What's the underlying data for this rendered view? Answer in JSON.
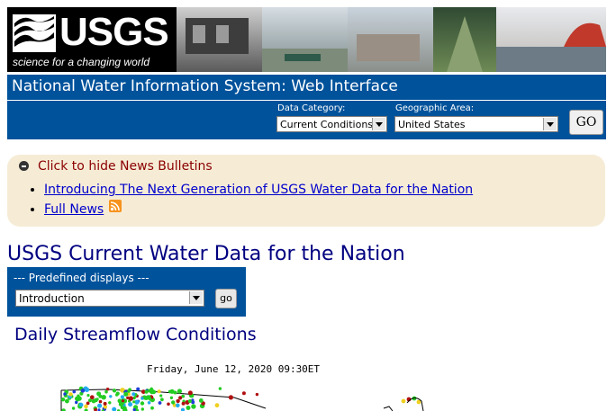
{
  "header": {
    "logo_text": "USGS",
    "tagline": "science for a changing world",
    "title": "National Water Information System: Web Interface"
  },
  "toolbar": {
    "data_category_label": "Data Category:",
    "data_category_value": "Current Conditions",
    "geographic_area_label": "Geographic Area:",
    "geographic_area_value": "United States",
    "go_label": "GO"
  },
  "news": {
    "toggle_label": "Click to hide News Bulletins",
    "items": [
      {
        "label": "Introducing The Next Generation of USGS Water Data for the Nation"
      },
      {
        "label": "Full News"
      }
    ]
  },
  "main": {
    "heading": "USGS Current Water Data for the Nation",
    "predefined": {
      "caption": "--- Predefined displays ---",
      "selected": "Introduction",
      "go_label": "go"
    },
    "section_heading": "Daily Streamflow Conditions",
    "map_timestamp": "Friday, June 12, 2020 09:30ET"
  },
  "colors": {
    "banner_blue": "#00529b",
    "heading_navy": "#000080",
    "news_bg": "#f6ecd6"
  },
  "icons": [
    "usgs-logo-mark",
    "collapse-icon",
    "rss-icon",
    "dropdown-arrow-icon"
  ]
}
